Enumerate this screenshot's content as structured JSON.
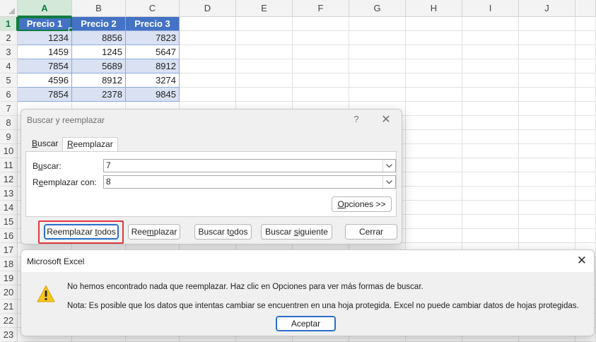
{
  "sheet": {
    "columns": [
      "A",
      "B",
      "C",
      "D",
      "E",
      "F",
      "G",
      "H",
      "I",
      "J"
    ],
    "rows": [
      "1",
      "2",
      "3",
      "4",
      "5",
      "6",
      "7",
      "8",
      "9",
      "10",
      "11",
      "12",
      "13",
      "14",
      "15",
      "16",
      "17",
      "18",
      "19",
      "20",
      "21",
      "22",
      "23"
    ],
    "headers": [
      "Precio 1",
      "Precio 2",
      "Precio 3"
    ],
    "data": [
      [
        "1234",
        "8856",
        "7823"
      ],
      [
        "1459",
        "1245",
        "5647"
      ],
      [
        "7854",
        "5689",
        "8912"
      ],
      [
        "4596",
        "8912",
        "3274"
      ],
      [
        "7854",
        "2378",
        "9845"
      ]
    ],
    "colors": {
      "table_header": "#4472c4",
      "band": "#d9e1f2",
      "selection": "#107c41"
    }
  },
  "find_dialog": {
    "title": "Buscar y reemplazar",
    "help": "?",
    "close": "✕",
    "tabs": [
      "Buscar",
      "Reemplazar"
    ],
    "active_tab": "Reemplazar",
    "find_label": "Buscar:",
    "find_value": "7",
    "replace_label": "Reemplazar con:",
    "replace_value": "8",
    "options_label": "Opciones >>",
    "buttons": [
      "Reemplazar todos",
      "Reemplazar",
      "Buscar todos",
      "Buscar siguiente",
      "Cerrar"
    ],
    "highlight_color": "#e0393e"
  },
  "message_box": {
    "title": "Microsoft Excel",
    "close": "✕",
    "icon": "warning-icon",
    "line1": "No hemos encontrado nada que reemplazar. Haz clic en Opciones para ver más formas de buscar.",
    "line2": "Nota: Es posible que los datos que intentas cambiar se encuentren en una hoja protegida. Excel no puede cambiar datos de hojas protegidas.",
    "ok_label": "Aceptar"
  }
}
